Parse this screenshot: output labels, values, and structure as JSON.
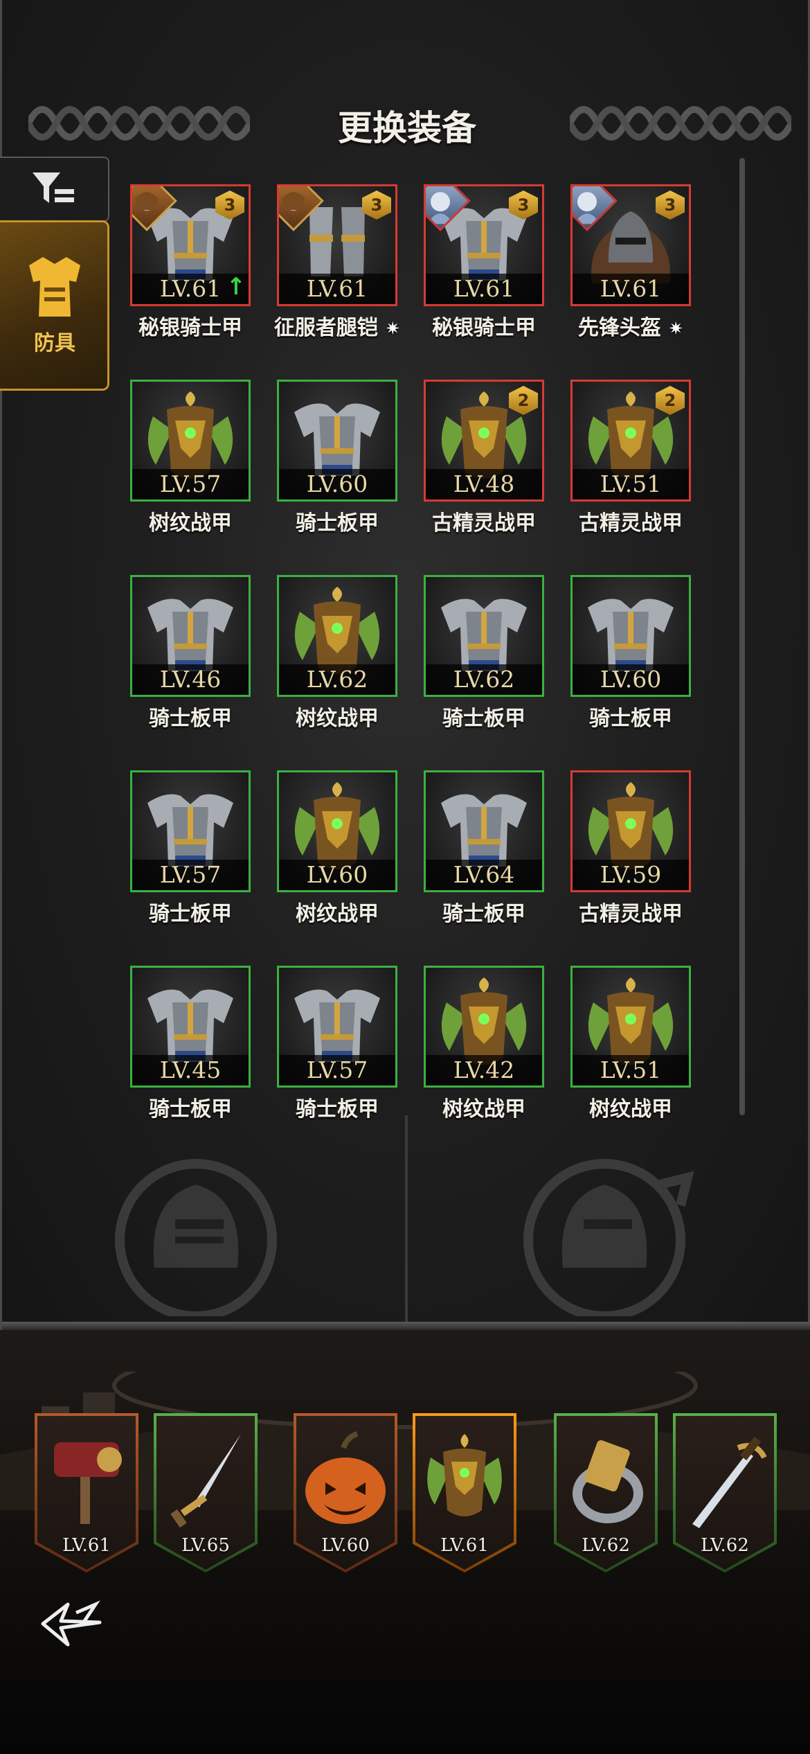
{
  "header": {
    "title": "更换装备"
  },
  "sidebar": {
    "filter_icon": "filter-icon",
    "tab_armor_label": "防具",
    "tab_armor_icon": "chest-armor-icon"
  },
  "grid": [
    {
      "level": "LV.61",
      "name": "秘银骑士甲",
      "border": "red",
      "stars": "3",
      "hero": "orange",
      "upgrade": true,
      "art": "plate"
    },
    {
      "level": "LV.61",
      "name": "征服者腿铠",
      "border": "red",
      "stars": "3",
      "hero": "orange",
      "special": true,
      "art": "legs"
    },
    {
      "level": "LV.61",
      "name": "秘银骑士甲",
      "border": "red",
      "stars": "3",
      "hero": "blue",
      "art": "plate"
    },
    {
      "level": "LV.61",
      "name": "先锋头盔",
      "border": "red",
      "stars": "3",
      "hero": "blue",
      "special": true,
      "art": "helm"
    },
    {
      "level": "LV.57",
      "name": "树纹战甲",
      "border": "green",
      "art": "leaf"
    },
    {
      "level": "LV.60",
      "name": "骑士板甲",
      "border": "green",
      "art": "plate"
    },
    {
      "level": "LV.48",
      "name": "古精灵战甲",
      "border": "red",
      "stars": "2",
      "art": "leaf"
    },
    {
      "level": "LV.51",
      "name": "古精灵战甲",
      "border": "red",
      "stars": "2",
      "art": "leaf"
    },
    {
      "level": "LV.46",
      "name": "骑士板甲",
      "border": "green",
      "art": "plate"
    },
    {
      "level": "LV.62",
      "name": "树纹战甲",
      "border": "green",
      "art": "leaf"
    },
    {
      "level": "LV.62",
      "name": "骑士板甲",
      "border": "green",
      "art": "plate"
    },
    {
      "level": "LV.60",
      "name": "骑士板甲",
      "border": "green",
      "art": "plate"
    },
    {
      "level": "LV.57",
      "name": "骑士板甲",
      "border": "green",
      "art": "plate"
    },
    {
      "level": "LV.60",
      "name": "树纹战甲",
      "border": "green",
      "art": "leaf"
    },
    {
      "level": "LV.64",
      "name": "骑士板甲",
      "border": "green",
      "art": "plate"
    },
    {
      "level": "LV.59",
      "name": "古精灵战甲",
      "border": "red",
      "art": "leaf"
    },
    {
      "level": "LV.45",
      "name": "骑士板甲",
      "border": "green",
      "art": "plate"
    },
    {
      "level": "LV.57",
      "name": "骑士板甲",
      "border": "green",
      "art": "plate"
    },
    {
      "level": "LV.42",
      "name": "树纹战甲",
      "border": "green",
      "art": "leaf"
    },
    {
      "level": "LV.51",
      "name": "树纹战甲",
      "border": "green",
      "art": "leaf"
    }
  ],
  "equipped": [
    {
      "level": "LV.61",
      "art": "hammer",
      "frame": "bronze"
    },
    {
      "level": "LV.65",
      "art": "dagger",
      "frame": "green"
    },
    {
      "level": "LV.60",
      "art": "pumpkin",
      "frame": "bronze"
    },
    {
      "level": "LV.61",
      "art": "leaf",
      "frame": "orange"
    },
    {
      "level": "LV.62",
      "art": "ring",
      "frame": "green"
    },
    {
      "level": "LV.62",
      "art": "sword",
      "frame": "green"
    }
  ],
  "footer": {
    "back_icon": "back-arrow-icon"
  },
  "colors": {
    "green_border": "#3bb13f",
    "red_border": "#d83a33",
    "gold_accent": "#c8922a",
    "level_text": "#e9d8a6"
  }
}
